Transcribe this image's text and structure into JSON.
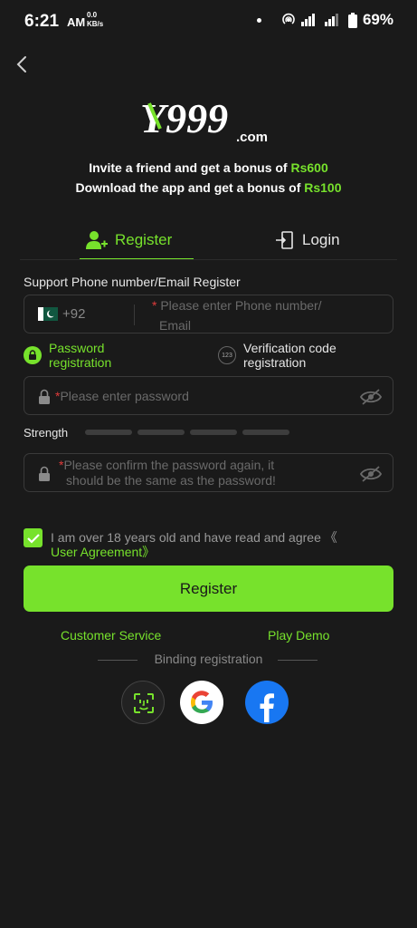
{
  "status_bar": {
    "time": "6:21",
    "ampm": "AM",
    "net_speed_value": "0.0",
    "net_speed_unit": "KB/s",
    "battery": "69%"
  },
  "brand": {
    "logo_text": "Y999",
    "logo_suffix": ".com"
  },
  "promo": {
    "line1_prefix": "Invite a friend and get a bonus of ",
    "line1_amount": "Rs600",
    "line2_prefix": "Download the app and get a bonus of ",
    "line2_amount": "Rs100"
  },
  "tabs": [
    {
      "label": "Register",
      "icon": "user-add-icon",
      "active": true
    },
    {
      "label": "Login",
      "icon": "login-door-icon",
      "active": false
    }
  ],
  "form": {
    "section_label": "Support Phone number/Email Register",
    "country_code": "+92",
    "phone_placeholder_line1": "Please enter Phone number/",
    "phone_placeholder_line2": "Email",
    "methods": {
      "password_line1": "Password",
      "password_line2": "registration",
      "verification_icon_text": "123",
      "verification_line1": "Verification code",
      "verification_line2": "registration"
    },
    "password_placeholder": "Please enter password",
    "strength_label": "Strength",
    "confirm_placeholder_line1": "Please confirm the password again, it",
    "confirm_placeholder_line2": "should be the same as the password!",
    "agreement_text": "I am over 18 years old and have read and agree 《",
    "agreement_link": "User Agreement》",
    "agreement_checked": true,
    "submit_label": "Register"
  },
  "footer": {
    "customer_service": "Customer Service",
    "play_demo": "Play Demo",
    "binding_label": "Binding registration",
    "social": [
      "face-id-icon",
      "google-icon",
      "facebook-icon"
    ]
  },
  "colors": {
    "accent": "#77e22c",
    "background": "#1a1a1a",
    "required_star": "#e03b3b"
  }
}
